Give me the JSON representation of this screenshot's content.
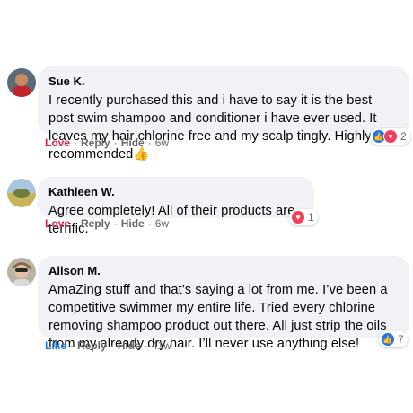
{
  "comments": [
    {
      "author": "Sue K.",
      "text": "I recently purchased this and i have to say it is the best post swim shampoo and conditioner i have ever used. It leaves my hair chlorine free and my scalp tingly. Highly recommended👍",
      "action_react": "Love",
      "action_reply": "Reply",
      "action_hide": "Hide",
      "time": "6w",
      "reaction_count": "2",
      "reaction_icons": [
        "like-icon",
        "love-icon"
      ]
    },
    {
      "author": "Kathleen W.",
      "text": "Agree completely! All of their products are terrific.",
      "action_react": "Love",
      "action_reply": "Reply",
      "action_hide": "Hide",
      "time": "6w",
      "reaction_count": "1",
      "reaction_icons": [
        "love-icon"
      ]
    },
    {
      "author": "Alison M.",
      "text": "AmaZing stuff and that’s saying a lot from me. I’ve been a competitive swimmer my entire life. Tried every chlorine removing shampoo product out there. All just strip the oils from my already dry hair. I’ll never use anything else!",
      "action_react": "Like",
      "action_reply": "Reply",
      "action_hide": "Hide",
      "time": "41w",
      "reaction_count": "7",
      "reaction_icons": [
        "like-icon"
      ]
    }
  ],
  "separator": "·",
  "colors": {
    "bubble": "#f0f2f5",
    "love": "#e41e3f",
    "like": "#1877f2",
    "meta": "#65676b"
  }
}
